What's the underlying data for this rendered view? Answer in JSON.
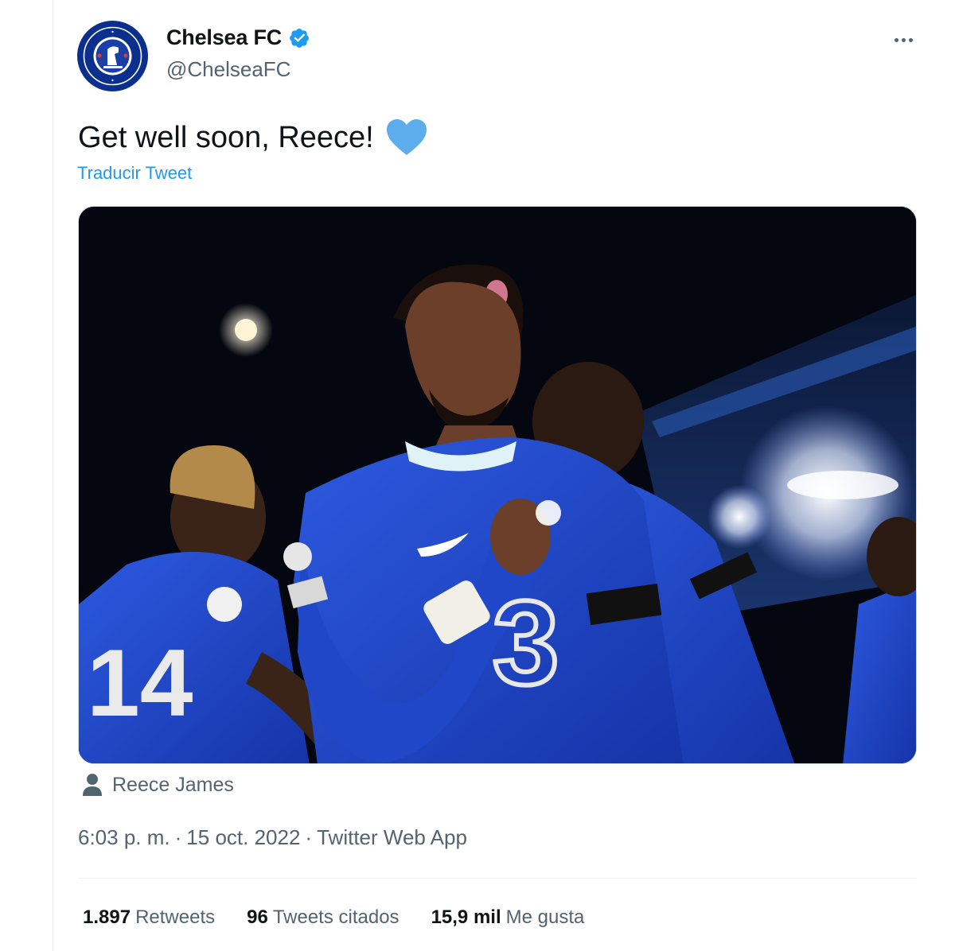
{
  "author": {
    "display_name": "Chelsea FC",
    "handle": "@ChelseaFC",
    "avatar_icon": "chelsea-crest-icon",
    "verified_icon": "verified-badge-icon",
    "verified_color": "#1d9bf0"
  },
  "tweet": {
    "text": "Get well soon, Reece!",
    "emoji_icon": "blue-heart-icon",
    "emoji_color": "#5dadec",
    "translate_label": "Traducir Tweet",
    "tagged_person": "Reece James",
    "time": "6:03 p. m.",
    "date": "15 oct. 2022",
    "source": "Twitter Web App"
  },
  "stats": [
    {
      "value": "1.897",
      "label": "Retweets"
    },
    {
      "value": "96",
      "label": "Tweets citados"
    },
    {
      "value": "15,9 mil",
      "label": "Me gusta"
    }
  ],
  "colors": {
    "link": "#1d9bf0",
    "secondary_text": "#536471",
    "primary_text": "#0f1419",
    "jersey_blue": "#1f47c8"
  }
}
